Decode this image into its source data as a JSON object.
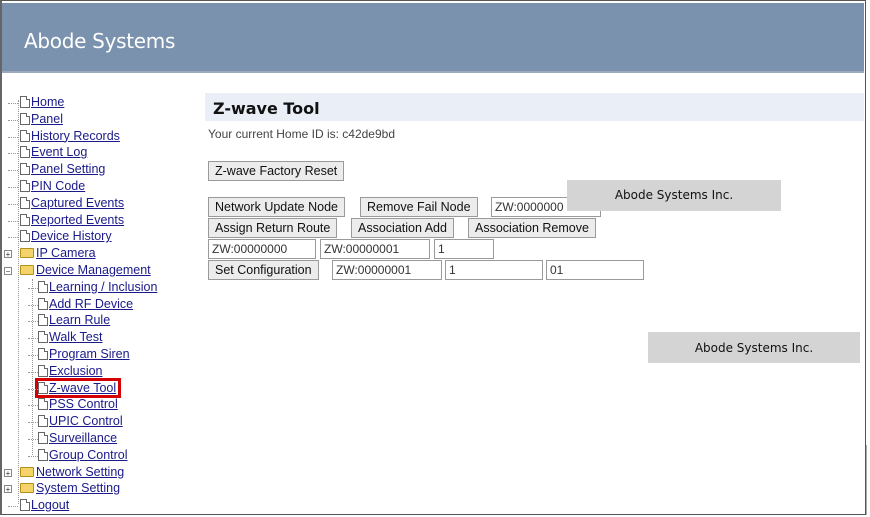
{
  "header": {
    "title": "Abode Systems"
  },
  "nav": {
    "home": "Home",
    "panel": "Panel",
    "history_records": "History Records",
    "event_log": "Event Log",
    "panel_setting": "Panel Setting",
    "pin_code": "PIN Code",
    "captured_events": "Captured Events",
    "reported_events": "Reported Events",
    "device_history": "Device History",
    "ip_camera": "IP Camera",
    "device_management": "Device Management",
    "dm": {
      "learning_inclusion": "Learning / Inclusion",
      "add_rf_device": "Add RF Device",
      "learn_rule": "Learn Rule",
      "walk_test": "Walk Test",
      "program_siren": "Program Siren",
      "exclusion": "Exclusion",
      "zwave_tool": "Z-wave Tool",
      "pss_control": "PSS Control",
      "upic_control": "UPIC Control",
      "surveillance": "Surveillance",
      "group_control": "Group Control"
    },
    "network_setting": "Network Setting",
    "system_setting": "System Setting",
    "logout": "Logout"
  },
  "main": {
    "title": "Z-wave Tool",
    "home_id_text": "Your current Home ID is: c42de9bd",
    "factory_reset": "Z-wave Factory Reset",
    "network_update_node": "Network Update Node",
    "remove_fail_node": "Remove Fail Node",
    "remove_fail_value": "ZW:0000000",
    "assign_return_route": "Assign Return Route",
    "association_add": "Association Add",
    "association_remove": "Association Remove",
    "route_src": "ZW:00000000",
    "route_dst": "ZW:00000001",
    "route_idx": "1",
    "set_configuration": "Set Configuration",
    "config_node": "ZW:00000001",
    "config_param": "1",
    "config_value": "01"
  },
  "overlays": {
    "watermark1": "Abode Systems Inc.",
    "watermark2": "Abode Systems Inc."
  },
  "colors": {
    "header_bg": "#7a92ae",
    "highlight": "#d40000",
    "title_bar": "#e9eef7"
  }
}
